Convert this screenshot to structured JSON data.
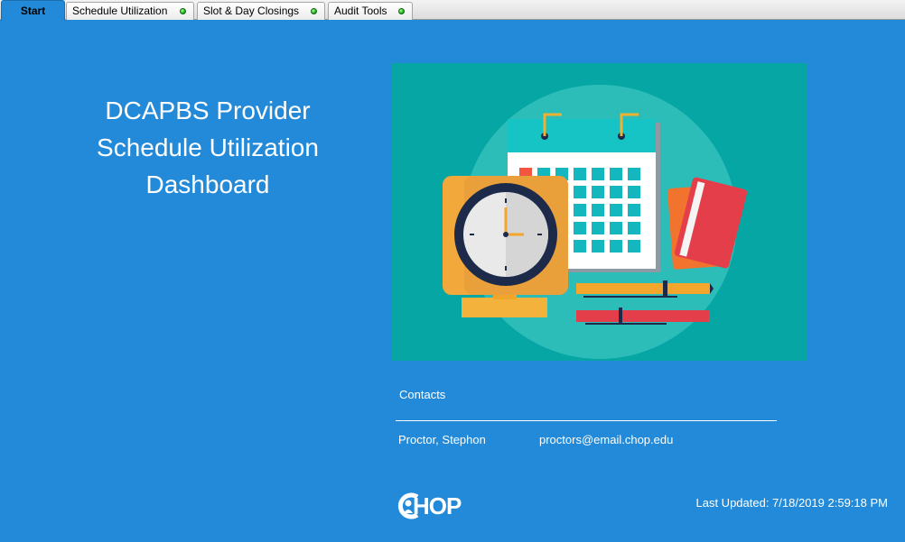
{
  "tabs": [
    {
      "label": "Start",
      "active": true
    },
    {
      "label": "Schedule Utilization",
      "active": false
    },
    {
      "label": "Slot & Day Closings",
      "active": false
    },
    {
      "label": "Audit Tools",
      "active": false
    }
  ],
  "dashboard": {
    "title_line1": "DCAPBS Provider",
    "title_line2": "Schedule Utilization",
    "title_line3": "Dashboard"
  },
  "contacts": {
    "heading": "Contacts",
    "name": "Proctor, Stephon",
    "email": "proctors@email.chop.edu"
  },
  "logo": {
    "text": "HOP"
  },
  "footer": {
    "last_updated": "Last Updated: 7/18/2019 2:59:18 PM"
  },
  "colors": {
    "background": "#228ad8",
    "illustration_bg": "#06a6a4",
    "status_dot": "#22b322"
  }
}
